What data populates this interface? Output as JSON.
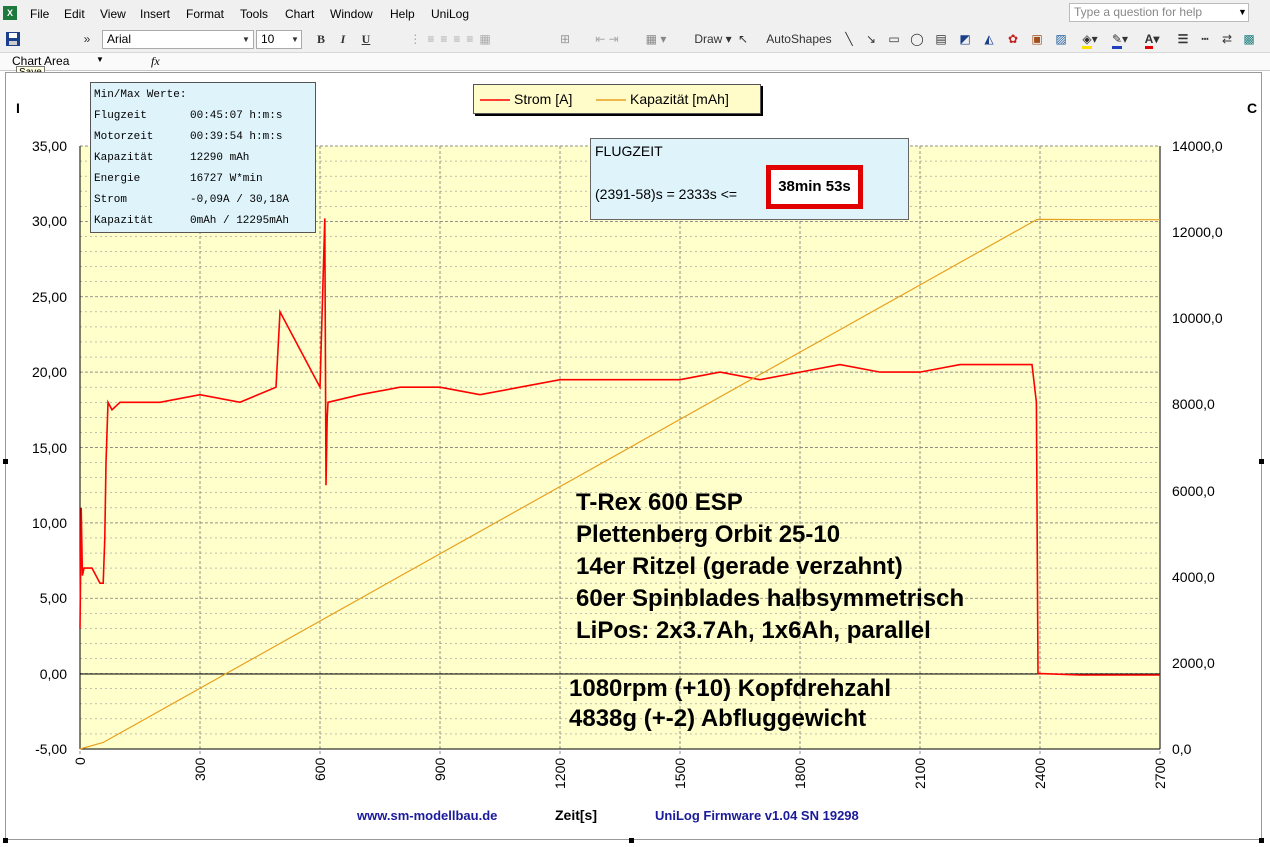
{
  "menubar": {
    "items": [
      "File",
      "Edit",
      "View",
      "Insert",
      "Format",
      "Tools",
      "Chart",
      "Window",
      "Help",
      "UniLog"
    ],
    "help_placeholder": "Type a question for help"
  },
  "toolbar": {
    "font_name": "Arial",
    "font_size": "10",
    "bold": "B",
    "italic": "I",
    "underline": "U",
    "draw_label": "Draw",
    "autoshapes_label": "AutoShapes"
  },
  "formulabar": {
    "name_box": "Chart Area",
    "fx": "fx"
  },
  "tooltip": "Save",
  "infobox": {
    "title": "Min/Max Werte:",
    "rows": [
      {
        "label": "Flugzeit",
        "value": "00:45:07 h:m:s"
      },
      {
        "label": "Motorzeit",
        "value": "00:39:54 h:m:s"
      },
      {
        "label": "Kapazität",
        "value": "12290 mAh"
      },
      {
        "label": "Energie",
        "value": "16727 W*min"
      },
      {
        "label": "Strom",
        "value": "-0,09A / 30,18A"
      },
      {
        "label": "Kapazität",
        "value": "0mAh / 12295mAh"
      }
    ]
  },
  "flugzeit": {
    "title": "FLUGZEIT",
    "formula": "(2391-58)s = 2333s <=",
    "result": "38min 53s"
  },
  "annotations": {
    "model_lines": [
      "T-Rex 600 ESP",
      "Plettenberg Orbit 25-10",
      "14er Ritzel (gerade verzahnt)",
      "60er Spinblades halbsymmetrisch",
      "LiPos: 2x3.7Ah, 1x6Ah, parallel"
    ],
    "rpm_line": "1080rpm (+10) Kopfdrehzahl",
    "weight_line": "4838g (+-2) Abfluggewicht"
  },
  "footer": {
    "website": "www.sm-modellbau.de",
    "firmware": "UniLog Firmware v1.04 SN 19298"
  },
  "chart_data": {
    "type": "line",
    "xlabel": "Zeit[s]",
    "left_axis_label": "I",
    "right_axis_label": "C",
    "xlim": [
      0,
      2700
    ],
    "ylim_left": [
      -5,
      35
    ],
    "ylim_right": [
      0,
      14000
    ],
    "x_ticks": [
      "0",
      "300",
      "600",
      "900",
      "1200",
      "1500",
      "1800",
      "2100",
      "2400",
      "2700"
    ],
    "left_ticks": [
      "35,00",
      "30,00",
      "25,00",
      "20,00",
      "15,00",
      "10,00",
      "5,00",
      "0,00",
      "-5,00"
    ],
    "right_ticks": [
      "14000,0",
      "12000,0",
      "10000,0",
      "8000,0",
      "6000,0",
      "4000,0",
      "2000,0",
      "0,0"
    ],
    "grid": true,
    "legend_position": "top-center",
    "colors": {
      "plot_bg": "#ffffcc",
      "strom": "#ff0000",
      "kapazitaet": "#e8a020",
      "grid": "#888888"
    },
    "series": [
      {
        "name": "Strom [A]",
        "axis": "left",
        "x": [
          0,
          3,
          6,
          10,
          20,
          30,
          40,
          50,
          55,
          58,
          62,
          65,
          70,
          80,
          100,
          150,
          200,
          300,
          400,
          490,
          500,
          600,
          612,
          615,
          618,
          620,
          700,
          800,
          900,
          1000,
          1100,
          1200,
          1300,
          1400,
          1500,
          1600,
          1700,
          1800,
          1900,
          2000,
          2100,
          2200,
          2300,
          2380,
          2391,
          2395,
          2400,
          2500,
          2600,
          2700
        ],
        "values": [
          3,
          11,
          6.5,
          7,
          7,
          7,
          6.5,
          6,
          6,
          6,
          9,
          14,
          18,
          17.5,
          18,
          18,
          18,
          18.5,
          18,
          19,
          24,
          19,
          30.2,
          12.5,
          17,
          18,
          18.5,
          19,
          19,
          18.5,
          19,
          19.5,
          19.5,
          19.5,
          19.5,
          20,
          19.5,
          20,
          20.5,
          20,
          20,
          20.5,
          20.5,
          20.5,
          18,
          0,
          0,
          -0.09,
          -0.09,
          -0.09
        ]
      },
      {
        "name": "Kapazität [mAh]",
        "axis": "right",
        "x": [
          0,
          58,
          2391,
          2400,
          2550,
          2700
        ],
        "values": [
          0,
          150,
          12290,
          12295,
          12290,
          12290
        ]
      }
    ]
  }
}
